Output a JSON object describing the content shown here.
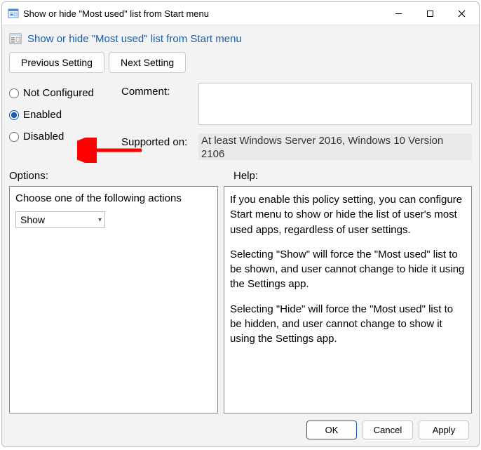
{
  "titlebar": {
    "title": "Show or hide \"Most used\" list from Start menu"
  },
  "header": {
    "title": "Show or hide \"Most used\" list from Start menu"
  },
  "nav": {
    "previous": "Previous Setting",
    "next": "Next Setting"
  },
  "state": {
    "not_configured": "Not Configured",
    "enabled": "Enabled",
    "disabled": "Disabled",
    "selected": "enabled",
    "comment_label": "Comment:",
    "comment_value": "",
    "supported_label": "Supported on:",
    "supported_value": "At least Windows Server 2016, Windows 10 Version 2106"
  },
  "panels": {
    "options_label": "Options:",
    "help_label": "Help:"
  },
  "options": {
    "action_label": "Choose one of the following actions",
    "dropdown_value": "Show"
  },
  "help": {
    "p1": "If you enable this policy setting, you can configure Start menu to show or hide the list of user's most used apps, regardless of user settings.",
    "p2": "Selecting \"Show\" will force the \"Most used\" list to be shown, and user cannot change to hide it using the Settings app.",
    "p3": "Selecting \"Hide\" will force the \"Most used\" list to be hidden, and user cannot change to show it using the Settings app."
  },
  "footer": {
    "ok": "OK",
    "cancel": "Cancel",
    "apply": "Apply"
  },
  "annotation": {
    "arrow_color": "#ff0000"
  }
}
